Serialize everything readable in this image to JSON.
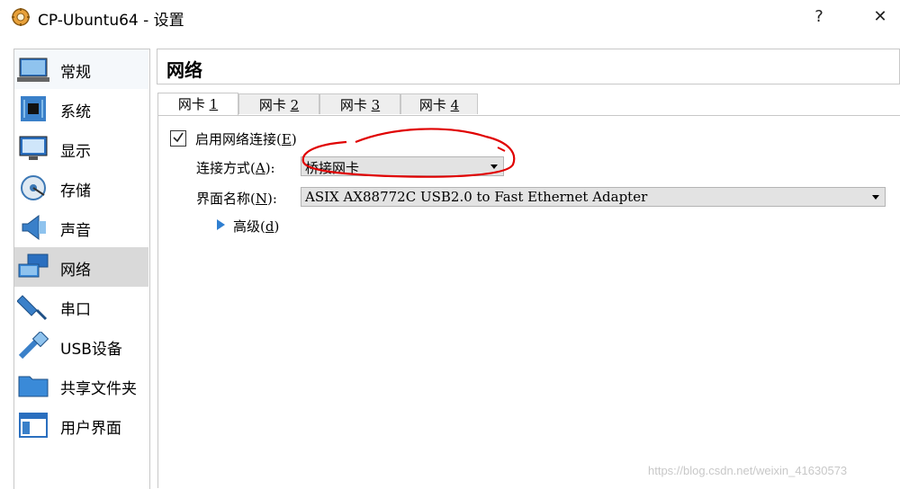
{
  "window": {
    "title": "CP-Ubuntu64 - 设置",
    "help": "?",
    "close": "✕"
  },
  "sidebar": {
    "items": [
      {
        "label": "常规",
        "icon": "general-icon"
      },
      {
        "label": "系统",
        "icon": "system-icon"
      },
      {
        "label": "显示",
        "icon": "display-icon"
      },
      {
        "label": "存储",
        "icon": "storage-icon"
      },
      {
        "label": "声音",
        "icon": "audio-icon"
      },
      {
        "label": "网络",
        "icon": "network-icon",
        "selected": true
      },
      {
        "label": "串口",
        "icon": "serial-port-icon"
      },
      {
        "label": "USB设备",
        "icon": "usb-icon"
      },
      {
        "label": "共享文件夹",
        "icon": "shared-folder-icon"
      },
      {
        "label": "用户界面",
        "icon": "user-interface-icon"
      }
    ]
  },
  "page": {
    "title": "网络"
  },
  "tabs": [
    {
      "prefix": "网卡 ",
      "num": "1",
      "active": true
    },
    {
      "prefix": "网卡 ",
      "num": "2"
    },
    {
      "prefix": "网卡 ",
      "num": "3"
    },
    {
      "prefix": "网卡 ",
      "num": "4"
    }
  ],
  "adapter": {
    "enable": {
      "label": "启用网络连接(",
      "key": "E",
      "suffix": ")",
      "checked": true
    },
    "attached": {
      "label": "连接方式(",
      "key": "A",
      "suffix": "):",
      "value": "桥接网卡"
    },
    "name": {
      "label": "界面名称(",
      "key": "N",
      "suffix": "):",
      "value": "ASIX AX88772C USB2.0 to Fast Ethernet Adapter"
    },
    "advanced": {
      "label": "高级(",
      "key": "d",
      "suffix": ")"
    }
  },
  "watermark": "https://blog.csdn.net/weixin_41630573",
  "colors": {
    "annotation": "#e00000",
    "selected_item": "#d9d9d9",
    "expander": "#2f7fd1"
  }
}
